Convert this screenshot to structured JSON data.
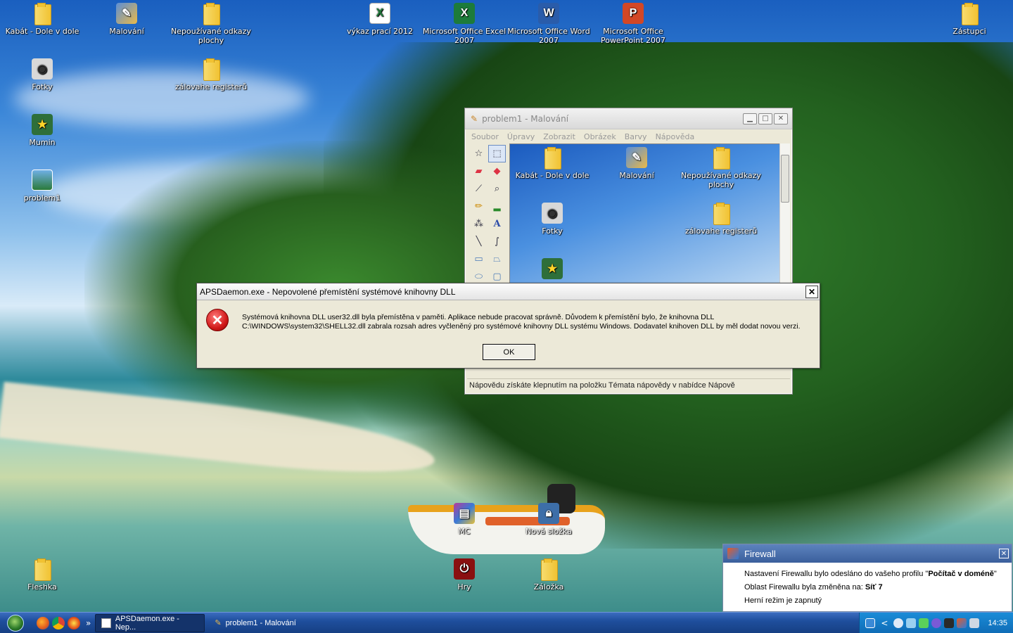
{
  "desktop": {
    "icons": [
      {
        "label": "Kabát - Dole v dole",
        "icon": "folder-icon"
      },
      {
        "label": "Malování",
        "icon": "paint-icon"
      },
      {
        "label": "Nepoužívané odkazy plochy",
        "icon": "folder-icon"
      },
      {
        "label": "výkaz prací 2012",
        "icon": "excel-file-icon"
      },
      {
        "label": "Microsoft Office Excel 2007",
        "icon": "excel-icon"
      },
      {
        "label": "Microsoft Office Word 2007",
        "icon": "word-icon"
      },
      {
        "label": "Microsoft Office PowerPoint 2007",
        "icon": "powerpoint-icon"
      },
      {
        "label": "Zástupci",
        "icon": "folder-icon"
      },
      {
        "label": "Fotky",
        "icon": "camera-icon"
      },
      {
        "label": "zálovahe registerů",
        "icon": "folder-icon"
      },
      {
        "label": "Mumin",
        "icon": "star-icon"
      },
      {
        "label": "problem1",
        "icon": "image-icon"
      },
      {
        "label": "MC",
        "icon": "archive-icon"
      },
      {
        "label": "Nová složka",
        "icon": "lock-folder-icon"
      },
      {
        "label": "Fleshka",
        "icon": "folder-icon"
      },
      {
        "label": "Hry",
        "icon": "power-icon"
      },
      {
        "label": "Záložka",
        "icon": "folder-icon"
      }
    ]
  },
  "paint": {
    "title": "problem1 - Malování",
    "menu": [
      "Soubor",
      "Úpravy",
      "Zobrazit",
      "Obrázek",
      "Barvy",
      "Nápověda"
    ],
    "canvas_icons": [
      "Kabát - Dole v dole",
      "Malování",
      "Nepoužívané odkazy plochy",
      "Fotky",
      "zálovahe registerů"
    ],
    "status": "Nápovědu získáte klepnutím na položku Témata nápovědy v nabídce Nápově"
  },
  "error_dialog": {
    "title": "APSDaemon.exe - Nepovolené přemístění systémové knihovny DLL",
    "message_line1": "Systémová knihovna DLL user32.dll byla přemístěna v paměti. Aplikace nebude pracovat správně. Důvodem k přemístění bylo, že knihovna DLL",
    "message_line2": "C:\\WINDOWS\\system32\\SHELL32.dll zabrala rozsah adres vyčleněný pro systémové knihovny DLL systému Windows. Dodavatel knihoven DLL by měl dodat novou verzi.",
    "ok_label": "OK",
    "close_label": "✕"
  },
  "firewall": {
    "title": "Firewall",
    "line1_prefix": "Nastavení Firewallu bylo odesláno do vašeho profilu \"",
    "line1_bold": "Počítač v doméně",
    "line1_suffix": "\"",
    "line2_prefix": "Oblast Firewallu byla změněna na: ",
    "line2_bold": "Síť 7",
    "line3": "Herní režim je zapnutý"
  },
  "taskbar": {
    "tasks": [
      "APSDaemon.exe - Nep...",
      "problem1 - Malování"
    ],
    "quicklaunch_more": "»",
    "tray_arrow": "<",
    "clock": "14:35"
  },
  "colors": {
    "error_red": "#d11a1a",
    "taskbar_blue": "#1f4f9d",
    "tray_blue": "#0f6bb5",
    "firewall_header": "#3a5f9c"
  }
}
